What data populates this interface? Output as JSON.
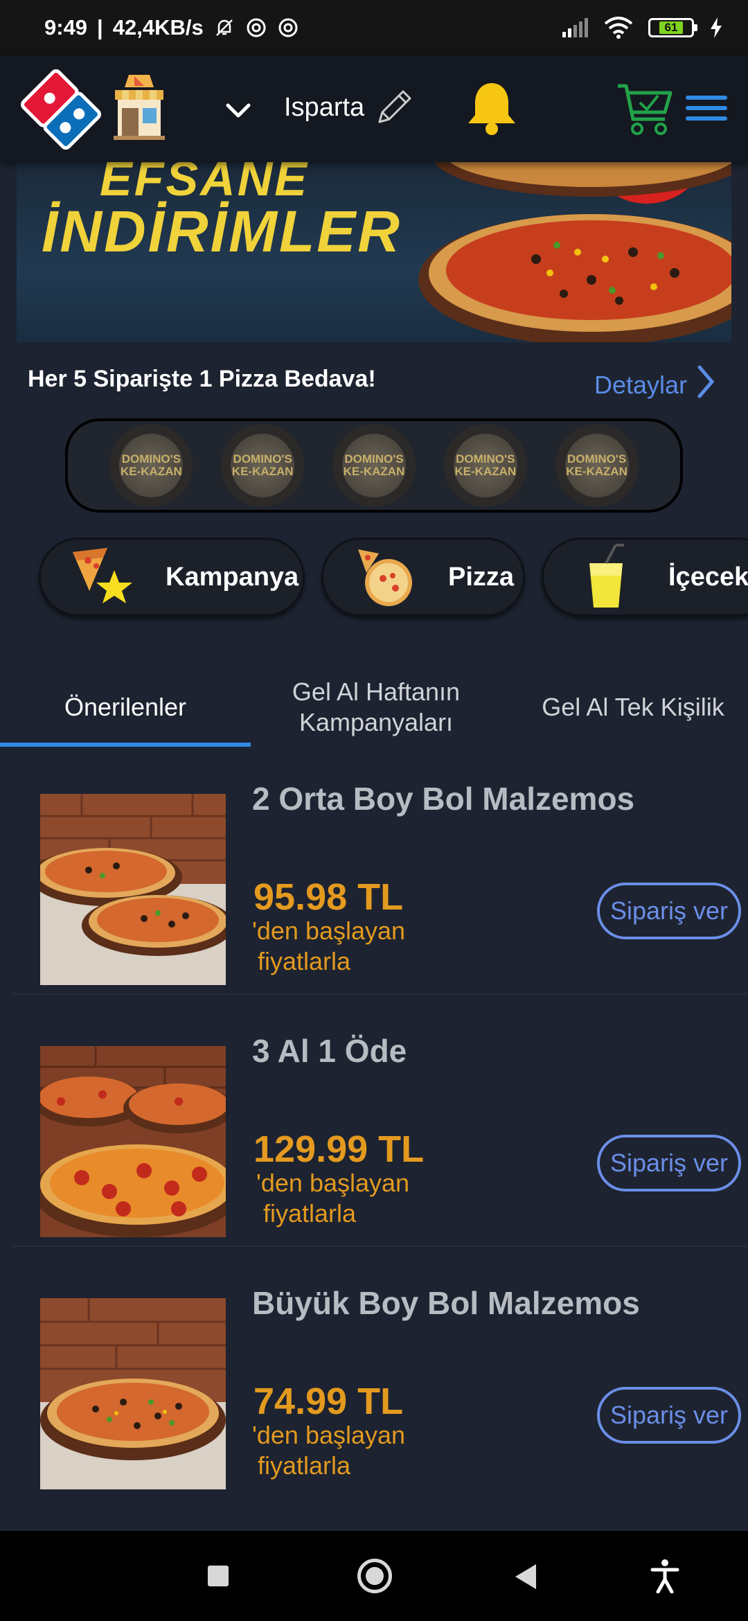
{
  "status_bar": {
    "time": "9:49",
    "network_speed": "42,4KB/s",
    "battery_level": "61",
    "icons": [
      "bell-muted-icon",
      "sync-icon",
      "sync-icon",
      "signal-icon",
      "wifi-icon",
      "battery-icon",
      "charging-icon"
    ]
  },
  "header": {
    "city": "Isparta",
    "icons": [
      "dominos-logo",
      "store-icon",
      "chevron-down-icon",
      "pencil-icon",
      "bell-icon",
      "cart-icon",
      "menu-icon"
    ],
    "accent_color": "#2f8be6"
  },
  "banner": {
    "line1": "EFSANE",
    "line2": "İNDİRİMLER"
  },
  "loyalty": {
    "text": "Her 5 Siparişte 1 Pizza Bedava!",
    "details_label": "Detaylar",
    "stamps": [
      {
        "label": "DOMINO'S KE-KAZAN"
      },
      {
        "label": "DOMINO'S KE-KAZAN"
      },
      {
        "label": "DOMINO'S KE-KAZAN"
      },
      {
        "label": "DOMINO'S KE-KAZAN"
      },
      {
        "label": "DOMINO'S KE-KAZAN"
      }
    ]
  },
  "categories": [
    {
      "label": "Kampanya",
      "icon": "pizza-star-icon"
    },
    {
      "label": "Pizza",
      "icon": "pizza-icon"
    },
    {
      "label": "İçecek",
      "icon": "drink-icon"
    }
  ],
  "tabs": [
    {
      "label": "Önerilenler",
      "active": true
    },
    {
      "label": "Gel Al Haftanın Kampanyaları",
      "active": false
    },
    {
      "label": "Gel Al Tek Kişilik",
      "active": false
    }
  ],
  "products": [
    {
      "name": "2 Orta Boy Bol Malzemos",
      "price": "95.98 TL",
      "suffix_1": "'den başlayan",
      "suffix_2": "fiyatlarla",
      "button": "Sipariş ver"
    },
    {
      "name": "3 Al 1 Öde",
      "price": "129.99 TL",
      "suffix_1": "'den başlayan",
      "suffix_2": "fiyatlarla",
      "button": "Sipariş ver"
    },
    {
      "name": "Büyük Boy Bol Malzemos",
      "price": "74.99 TL",
      "suffix_1": "'den başlayan",
      "suffix_2": "fiyatlarla",
      "button": "Sipariş ver"
    }
  ],
  "colors": {
    "background": "#1d2330",
    "price": "#e39a1f",
    "link": "#5b8de6",
    "button": "#6b8ee8"
  }
}
